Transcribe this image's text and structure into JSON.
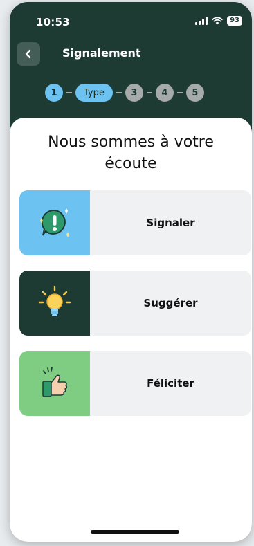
{
  "status_bar": {
    "time": "10:53",
    "battery": "93",
    "icons": [
      "signal-icon",
      "wifi-icon",
      "battery-icon"
    ]
  },
  "header": {
    "title": "Signalement",
    "back_icon": "chevron-left-icon"
  },
  "stepper": {
    "steps": [
      "1",
      "Type",
      "3",
      "4",
      "5"
    ],
    "current_index": 1
  },
  "main": {
    "headline_line1": "Nous sommes à votre",
    "headline_line2": "écoute",
    "options": [
      {
        "label": "Signaler",
        "icon": "exclamation-bubble-icon",
        "color": "#6cc2f0"
      },
      {
        "label": "Suggérer",
        "icon": "lightbulb-icon",
        "color": "#1d3a33"
      },
      {
        "label": "Féliciter",
        "icon": "thumbs-up-icon",
        "color": "#7fcd82"
      }
    ]
  },
  "colors": {
    "brand_dark": "#1d3a33",
    "accent_blue": "#6cc2f0",
    "pending_grey": "#a7aaab",
    "card_bg": "#eff1f3"
  }
}
